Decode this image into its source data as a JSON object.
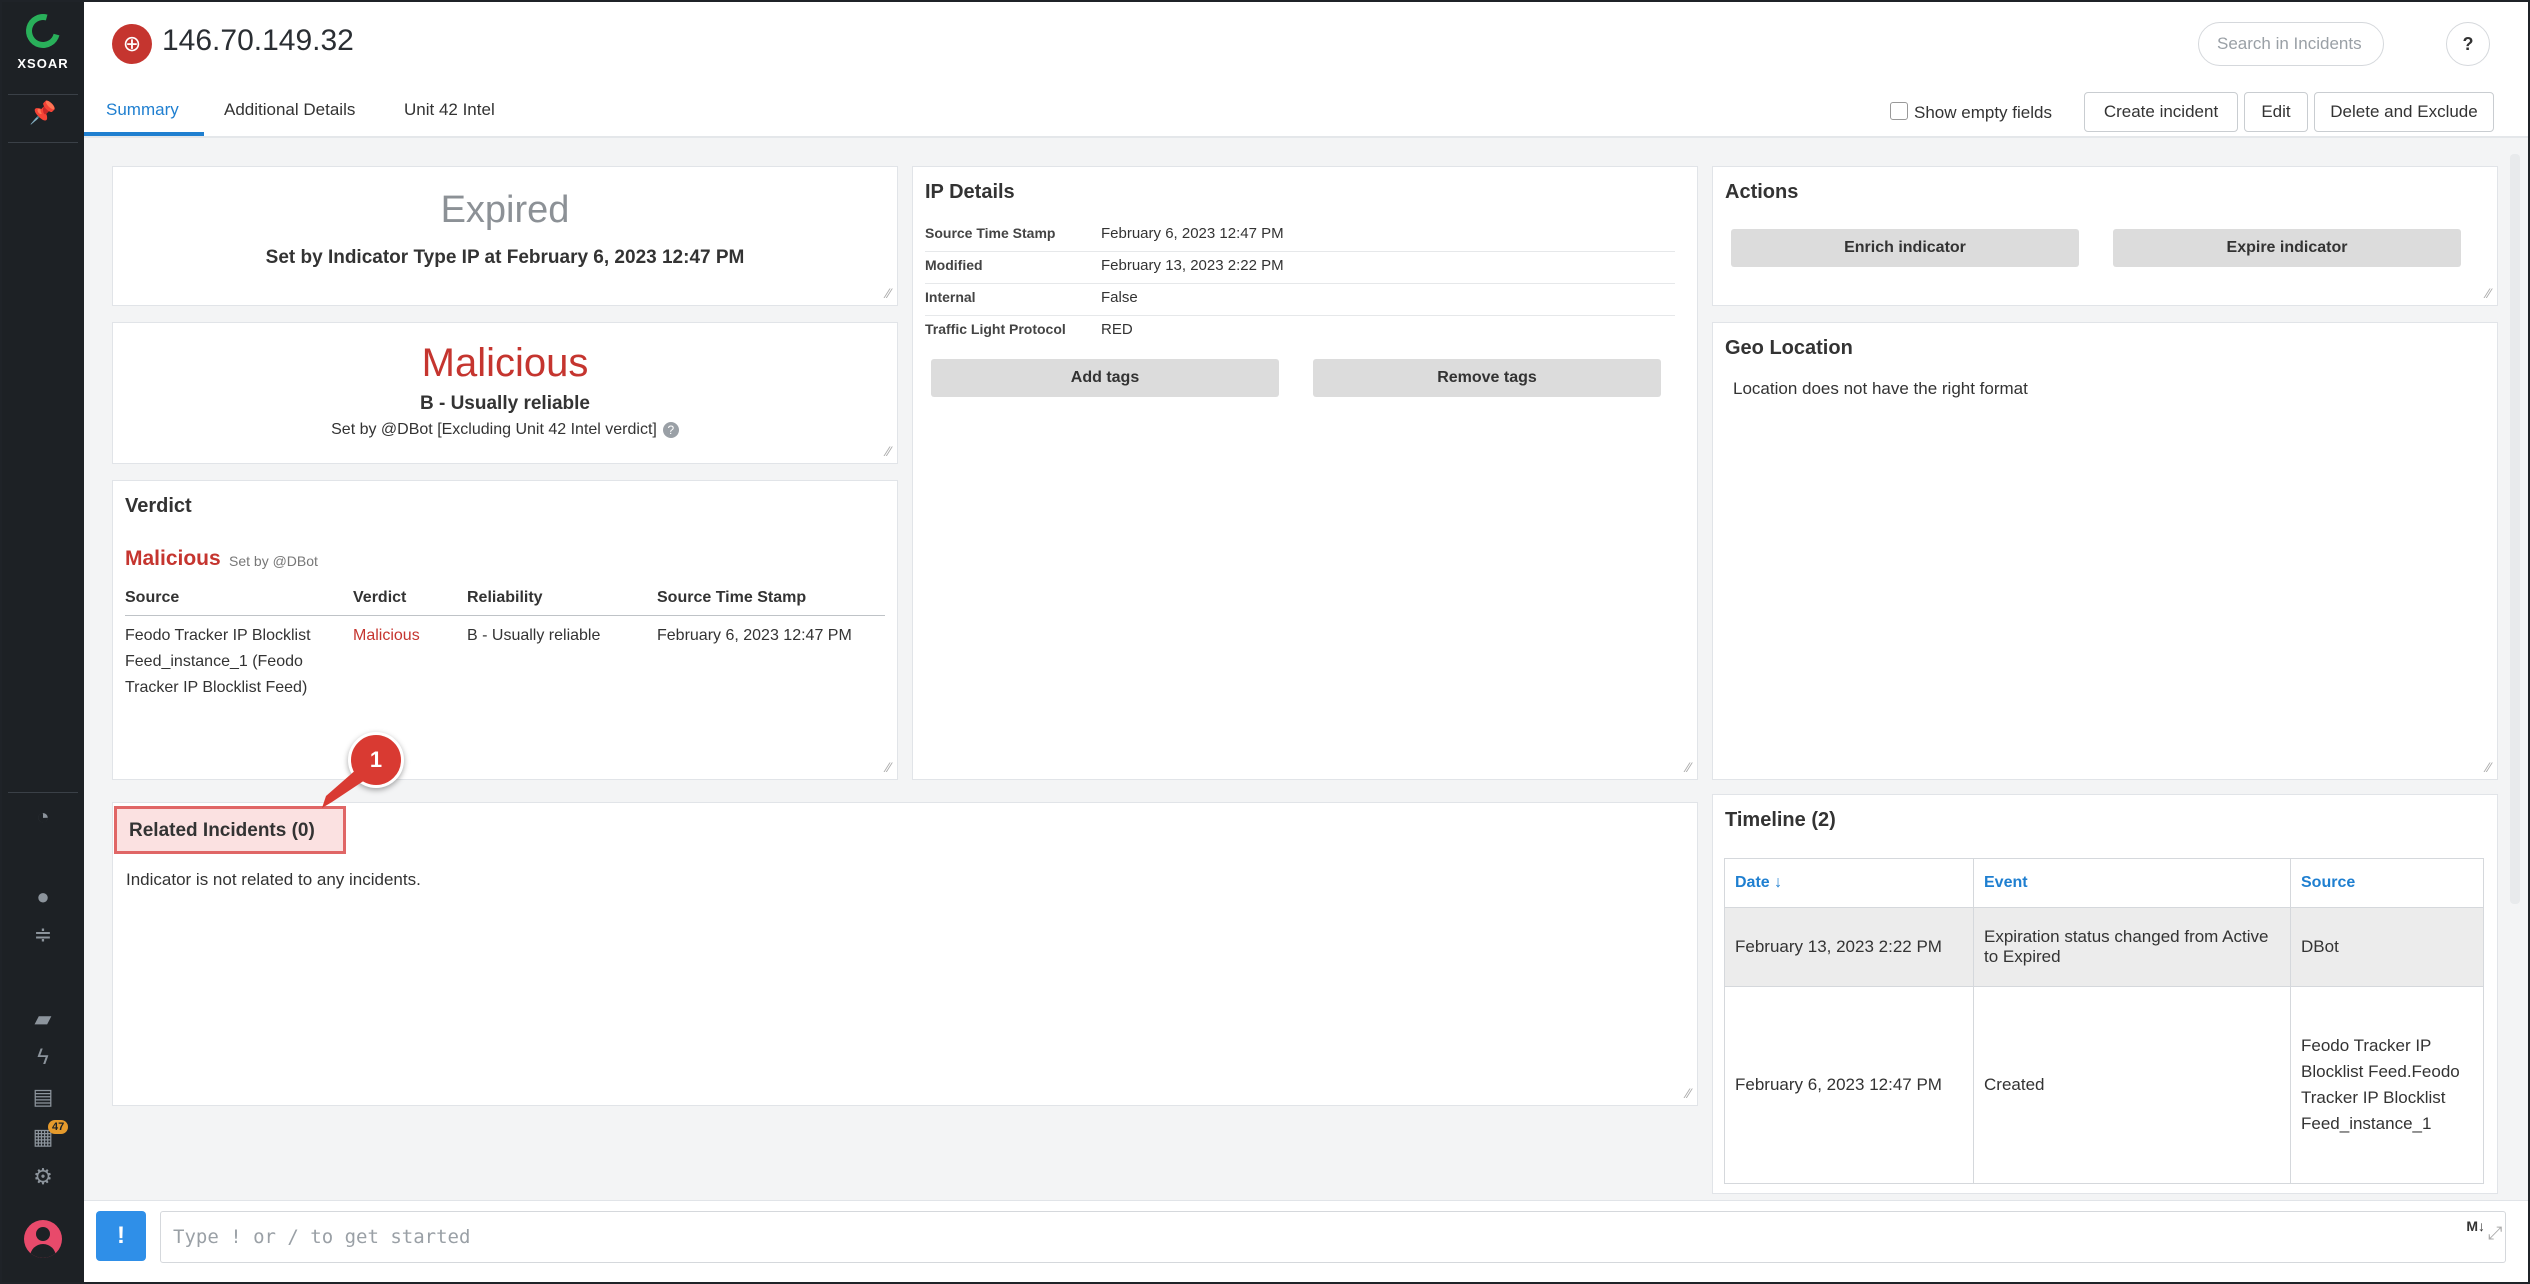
{
  "app": {
    "logo_text": "XSOAR"
  },
  "header": {
    "title": "146.70.149.32",
    "search_placeholder": "Search in Incidents",
    "help_label": "?"
  },
  "tabs": [
    {
      "label": "Summary",
      "active": true
    },
    {
      "label": "Additional Details",
      "active": false
    },
    {
      "label": "Unit 42 Intel",
      "active": false
    }
  ],
  "toolbar": {
    "show_empty_label": "Show empty fields",
    "create_incident": "Create incident",
    "edit": "Edit",
    "delete_exclude": "Delete and Exclude"
  },
  "expiration": {
    "status": "Expired",
    "detail": "Set by Indicator Type IP at February 6, 2023 12:47 PM"
  },
  "reputation": {
    "verdict": "Malicious",
    "reliability": "B - Usually reliable",
    "set_by": "Set by @DBot [Excluding Unit 42 Intel verdict]"
  },
  "verdict": {
    "title": "Verdict",
    "value": "Malicious",
    "set_by": "Set by @DBot",
    "columns": [
      "Source",
      "Verdict",
      "Reliability",
      "Source Time Stamp"
    ],
    "rows": [
      {
        "source": "Feodo Tracker IP Blocklist Feed_instance_1 (Feodo Tracker IP Blocklist Feed)",
        "verdict": "Malicious",
        "reliability": "B - Usually reliable",
        "timestamp": "February 6, 2023 12:47 PM"
      }
    ]
  },
  "ip_details": {
    "title": "IP Details",
    "fields": [
      {
        "key": "Source Time Stamp",
        "value": "February 6, 2023 12:47 PM"
      },
      {
        "key": "Modified",
        "value": "February 13, 2023 2:22 PM"
      },
      {
        "key": "Internal",
        "value": "False"
      },
      {
        "key": "Traffic Light Protocol",
        "value": "RED"
      }
    ],
    "add_tags": "Add tags",
    "remove_tags": "Remove tags"
  },
  "actions": {
    "title": "Actions",
    "enrich": "Enrich indicator",
    "expire": "Expire indicator"
  },
  "geo": {
    "title": "Geo Location",
    "message": "Location does not have the right format"
  },
  "related": {
    "title": "Related Incidents (0)",
    "message": "Indicator is not related to any incidents.",
    "callout": "1"
  },
  "timeline": {
    "title": "Timeline (2)",
    "columns": [
      "Date ↓",
      "Event",
      "Source"
    ],
    "rows": [
      {
        "date": "February 13, 2023 2:22 PM",
        "event": "Expiration status changed from Active to Expired",
        "source": "DBot"
      },
      {
        "date": "February 6, 2023 12:47 PM",
        "event": "Created",
        "source": "Feodo Tracker IP Blocklist Feed.Feodo Tracker IP Blocklist Feed_instance_1"
      }
    ]
  },
  "sidebar": {
    "badge_count": "47"
  },
  "chat": {
    "button": "!",
    "placeholder": "Type ! or / to get started",
    "markdown_label": "M↓"
  },
  "colors": {
    "accent": "#1f7fd0",
    "malicious": "#c5352f",
    "sidebar": "#1d2125",
    "logo": "#29b05a",
    "highlight": "#e06666"
  }
}
